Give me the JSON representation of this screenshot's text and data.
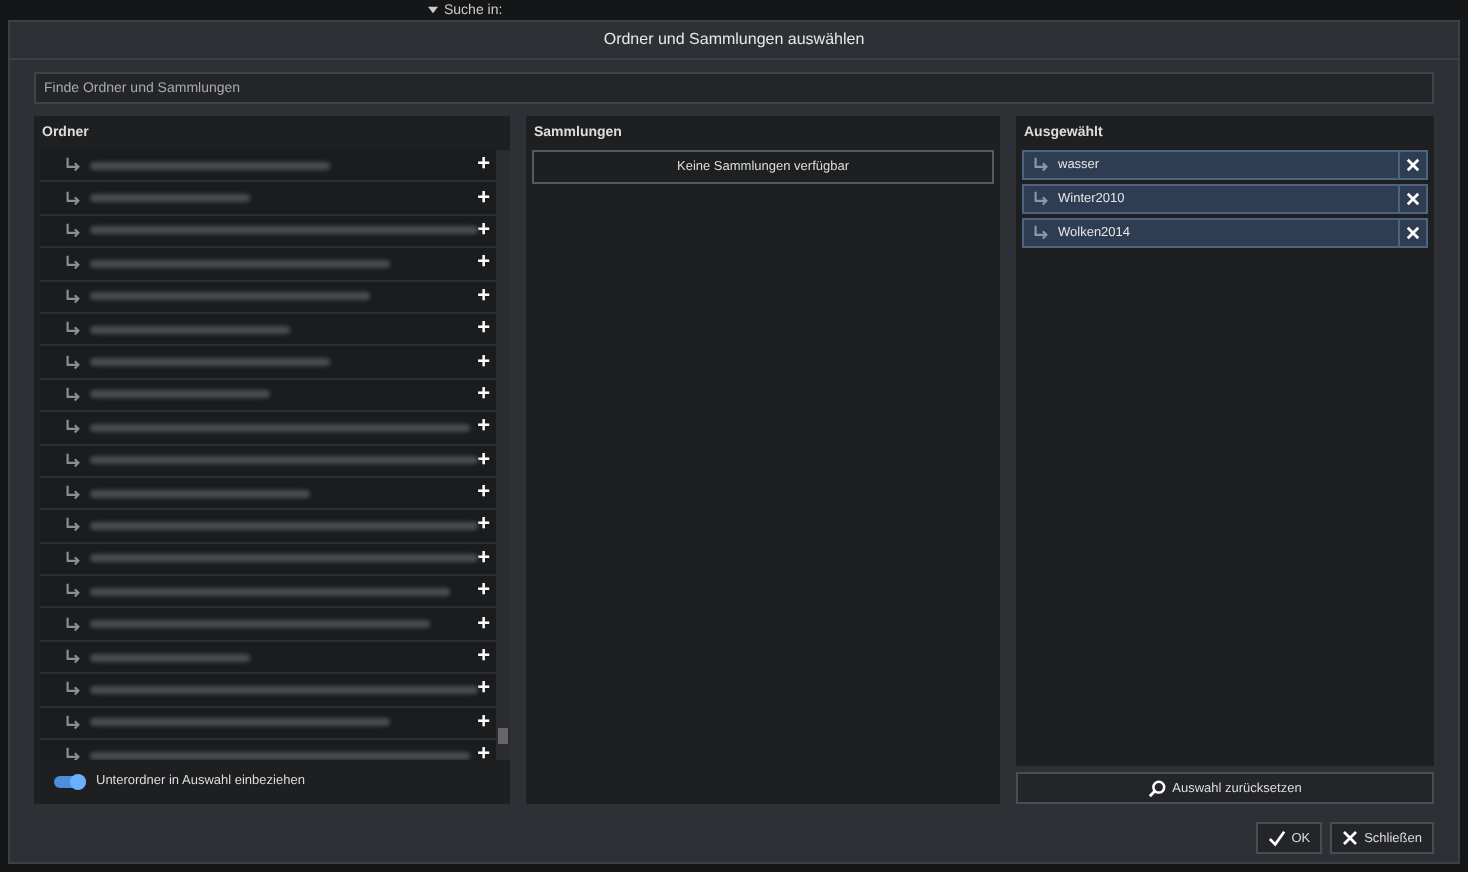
{
  "background": {
    "label": "Suche in:"
  },
  "window": {
    "title": "Ordner und Sammlungen auswählen"
  },
  "search": {
    "placeholder": "Finde Ordner und Sammlungen"
  },
  "folders": {
    "title": "Ordner",
    "items": [
      {
        "kind": "blurred",
        "add": "+"
      },
      {
        "kind": "blurred",
        "add": "+"
      },
      {
        "kind": "blurred",
        "add": "+"
      },
      {
        "kind": "blurred",
        "add": "+"
      },
      {
        "kind": "blurred",
        "add": "+"
      },
      {
        "kind": "blurred",
        "add": "+"
      },
      {
        "kind": "blurred",
        "add": "+"
      },
      {
        "kind": "blurred",
        "add": "+"
      },
      {
        "kind": "blurred",
        "add": "+"
      },
      {
        "kind": "blurred",
        "add": "+"
      },
      {
        "kind": "blurred",
        "add": "+"
      },
      {
        "kind": "blurred",
        "add": "+"
      },
      {
        "kind": "blurred",
        "add": "+"
      },
      {
        "kind": "blurred",
        "add": "+"
      },
      {
        "kind": "blurred",
        "add": "+"
      },
      {
        "kind": "blurred",
        "add": "+"
      },
      {
        "kind": "blurred",
        "add": "+"
      },
      {
        "kind": "blurred",
        "add": "+"
      },
      {
        "kind": "blurred",
        "add": "+"
      }
    ],
    "toggle": {
      "label": "Unterordner in Auswahl einbeziehen",
      "on": true
    }
  },
  "collections": {
    "title": "Sammlungen",
    "empty": "Keine Sammlungen verfügbar"
  },
  "selected": {
    "title": "Ausgewählt",
    "items": [
      {
        "label": "wasser"
      },
      {
        "label": "Winter2010"
      },
      {
        "label": "Wolken2014"
      }
    ],
    "reset": "Auswahl zurücksetzen"
  },
  "buttons": {
    "ok": "OK",
    "close": "Schließen"
  }
}
